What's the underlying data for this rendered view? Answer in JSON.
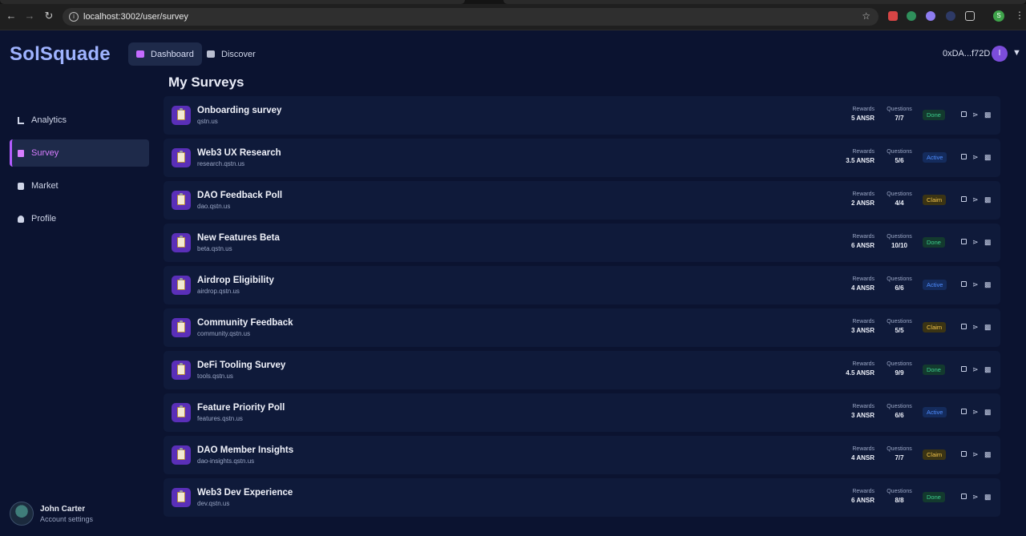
{
  "browser": {
    "url": "localhost:3002/user/survey"
  },
  "app": {
    "brand": "SolSquade",
    "topnav": [
      {
        "label": "Dashboard",
        "active": true,
        "icon": "home-icon"
      },
      {
        "label": "Discover",
        "active": false,
        "icon": "briefcase-icon"
      }
    ],
    "wallet": "0xDA...f72D",
    "user_initial": "I"
  },
  "sidebar": {
    "items": [
      {
        "label": "Analytics",
        "icon": "bar-chart-icon",
        "active": false
      },
      {
        "label": "Survey",
        "icon": "document-icon",
        "active": true
      },
      {
        "label": "Market",
        "icon": "bag-icon",
        "active": false
      },
      {
        "label": "Profile",
        "icon": "user-icon",
        "active": false
      }
    ],
    "profile": {
      "name": "John Carter",
      "sub": "Account settings"
    }
  },
  "main": {
    "title": "My Surveys",
    "rewards_label": "Rewards",
    "questions_label": "Questions",
    "surveys": [
      {
        "title": "Onboarding survey",
        "domain": "qstn.us",
        "rewards": "5 ANSR",
        "questions": "7/7",
        "status": "Done"
      },
      {
        "title": "Web3 UX Research",
        "domain": "research.qstn.us",
        "rewards": "3.5 ANSR",
        "questions": "5/6",
        "status": "Active"
      },
      {
        "title": "DAO Feedback Poll",
        "domain": "dao.qstn.us",
        "rewards": "2 ANSR",
        "questions": "4/4",
        "status": "Claim"
      },
      {
        "title": "New Features Beta",
        "domain": "beta.qstn.us",
        "rewards": "6 ANSR",
        "questions": "10/10",
        "status": "Done"
      },
      {
        "title": "Airdrop Eligibility",
        "domain": "airdrop.qstn.us",
        "rewards": "4 ANSR",
        "questions": "6/6",
        "status": "Active"
      },
      {
        "title": "Community Feedback",
        "domain": "community.qstn.us",
        "rewards": "3 ANSR",
        "questions": "5/5",
        "status": "Claim"
      },
      {
        "title": "DeFi Tooling Survey",
        "domain": "tools.qstn.us",
        "rewards": "4.5 ANSR",
        "questions": "9/9",
        "status": "Done"
      },
      {
        "title": "Feature Priority Poll",
        "domain": "features.qstn.us",
        "rewards": "3 ANSR",
        "questions": "6/6",
        "status": "Active"
      },
      {
        "title": "DAO Member Insights",
        "domain": "dao-insights.qstn.us",
        "rewards": "4 ANSR",
        "questions": "7/7",
        "status": "Claim"
      },
      {
        "title": "Web3 Dev Experience",
        "domain": "dev.qstn.us",
        "rewards": "6 ANSR",
        "questions": "8/8",
        "status": "Done"
      }
    ]
  }
}
